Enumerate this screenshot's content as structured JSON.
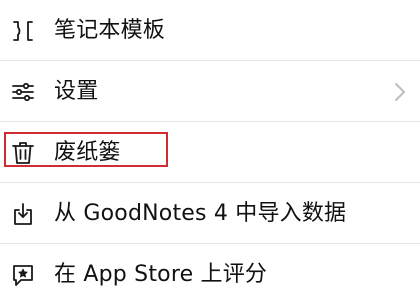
{
  "menu": {
    "items": [
      {
        "label": "笔记本模板",
        "icon": "template-icon",
        "has_chevron": false
      },
      {
        "label": "设置",
        "icon": "settings-sliders-icon",
        "has_chevron": true
      },
      {
        "label": "废纸篓",
        "icon": "trash-icon",
        "has_chevron": false,
        "highlighted": true
      },
      {
        "label": "从 GoodNotes 4 中导入数据",
        "icon": "import-icon",
        "has_chevron": false
      },
      {
        "label": "在 App Store 上评分",
        "icon": "rate-review-icon",
        "has_chevron": false
      }
    ]
  },
  "colors": {
    "text": "#111111",
    "divider": "#e6e6e6",
    "icon": "#1a1a1a",
    "chevron": "#bdbdbd",
    "highlight_border": "#d12b33"
  }
}
